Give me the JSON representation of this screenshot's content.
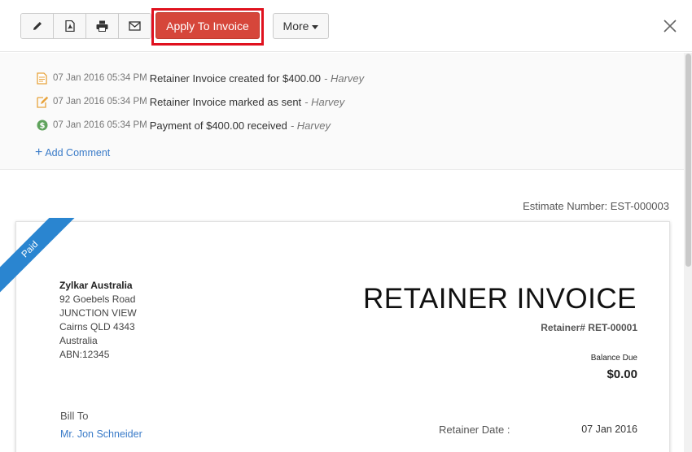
{
  "toolbar": {
    "edit_icon": "pencil-icon",
    "pdf_icon": "pdf-icon",
    "print_icon": "printer-icon",
    "email_icon": "envelope-icon",
    "apply_label": "Apply To Invoice",
    "more_label": "More",
    "close_icon": "close-icon",
    "apply_color": "#d6463a",
    "highlight_color": "#e0111e"
  },
  "activity": {
    "items": [
      {
        "icon": "document-icon",
        "time": "07 Jan 2016 05:34 PM",
        "message": "Retainer Invoice created for $400.00",
        "by": "- Harvey"
      },
      {
        "icon": "sent-icon",
        "time": "07 Jan 2016 05:34 PM",
        "message": "Retainer Invoice marked as sent",
        "by": "- Harvey"
      },
      {
        "icon": "payment-icon",
        "time": "07 Jan 2016 05:34 PM",
        "message": "Payment of $400.00 received",
        "by": "- Harvey"
      }
    ],
    "add_comment": "Add Comment"
  },
  "document": {
    "estimate_number": "Estimate Number: EST-000003",
    "status_ribbon": "Paid",
    "ribbon_color": "#2a85d0",
    "org": {
      "name": "Zylkar Australia",
      "address1": "92 Goebels Road",
      "address2": "JUNCTION VIEW",
      "address3": "Cairns QLD 4343",
      "country": "Australia",
      "abn": "ABN:12345"
    },
    "title": "RETAINER INVOICE",
    "retainer_number": "Retainer# RET-00001",
    "balance_label": "Balance Due",
    "balance_value": "$0.00",
    "bill_to_label": "Bill To",
    "bill_to_name": "Mr. Jon Schneider",
    "retainer_date_label": "Retainer Date :",
    "retainer_date_value": "07 Jan 2016"
  }
}
